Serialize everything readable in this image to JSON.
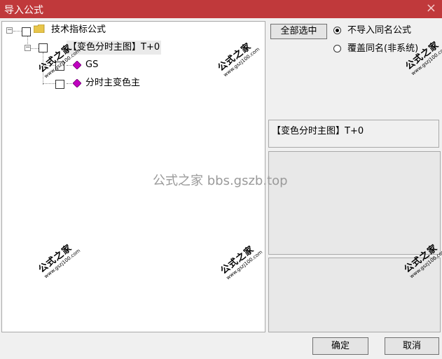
{
  "window": {
    "title": "导入公式",
    "close_glyph": "×"
  },
  "tree": {
    "root": {
      "label": "技术指标公式",
      "expander": "−"
    },
    "group": {
      "label": "【变色分时主图】T+0",
      "expander": "−"
    },
    "items": [
      {
        "label": "GS"
      },
      {
        "label": "分时主变色主"
      }
    ]
  },
  "toolbar": {
    "select_all_label": "全部选中"
  },
  "options": {
    "no_import_same_name": {
      "label": "不导入同名公式",
      "checked": true
    },
    "overwrite_same_name": {
      "label": "覆盖同名(非系统)",
      "checked": false
    }
  },
  "selected_formula_label": "【变色分时主图】T+0",
  "footer": {
    "ok_label": "确定",
    "cancel_label": "取消"
  },
  "watermark": {
    "center_text": "公式之家 bbs.gszb.top",
    "stamp_big": "公式之家",
    "stamp_small": "www.gszj100.com"
  },
  "colors": {
    "titlebar": "#c0393b",
    "gem": "#c000c0",
    "folder": "#e8c54a"
  }
}
